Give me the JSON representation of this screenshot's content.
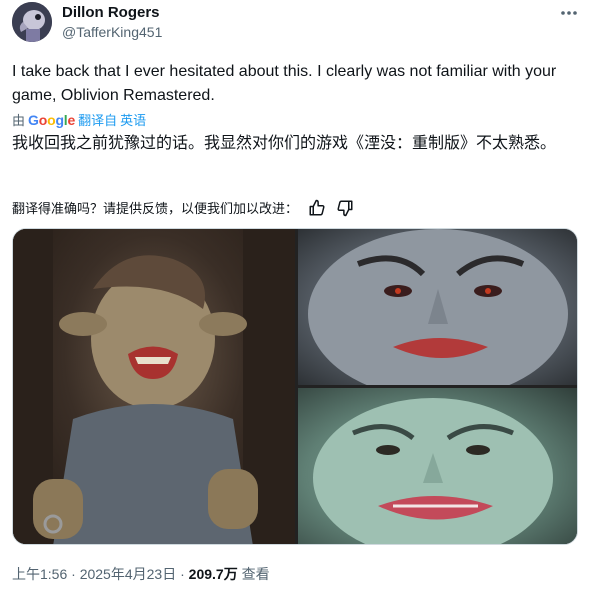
{
  "author": {
    "name": "Dillon Rogers",
    "handle": "@TafferKing451"
  },
  "tweet": {
    "text_en": "I take back that I ever hesitated about this. I clearly was not familiar with your game, Oblivion Remastered.",
    "translated_prefix": "由",
    "google_word": [
      "G",
      "o",
      "o",
      "g",
      "l",
      "e"
    ],
    "translated_suffix": "翻译自",
    "source_language": "英语",
    "text_zh": "我收回我之前犹豫过的话。我显然对你们的游戏《湮没：重制版》不太熟悉。",
    "feedback_prompt": "翻译得准确吗？请提供反馈，以便我们加以改进："
  },
  "footer": {
    "time": "上午1:56",
    "sep1": "·",
    "date": "2025年4月23日",
    "sep2": "·",
    "views_count": "209.7万",
    "views_label": "查看"
  },
  "icons": {
    "more": "more-dots-icon",
    "thumbs_up": "thumbs-up-icon",
    "thumbs_down": "thumbs-down-icon"
  },
  "colors": {
    "text_primary": "#0f1419",
    "text_secondary": "#536471",
    "link_blue": "#1d9bf0"
  }
}
